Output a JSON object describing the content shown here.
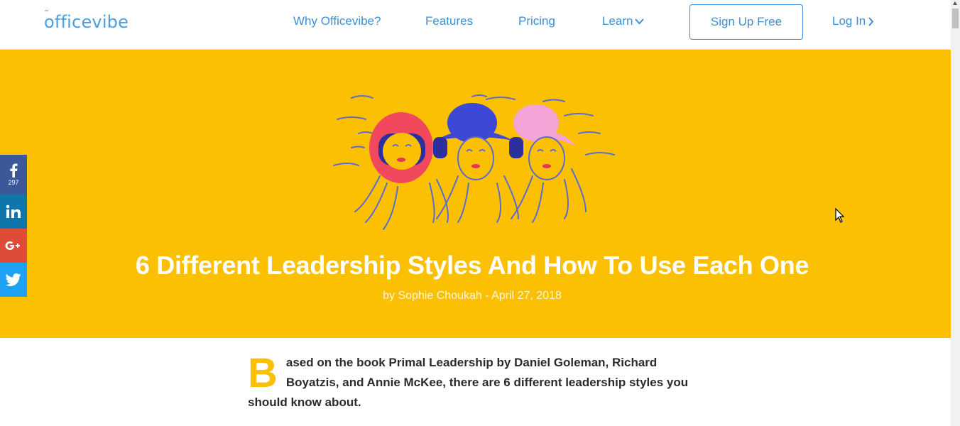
{
  "nav": {
    "logo": "officevibe",
    "links": [
      "Why Officevibe?",
      "Features",
      "Pricing",
      "Learn"
    ],
    "signup": "Sign Up Free",
    "login": "Log In"
  },
  "hero": {
    "title": "6 Different Leadership Styles And How To Use Each One",
    "meta": "by Sophie Choukah - April 27, 2018"
  },
  "share": {
    "facebook_count": "297"
  },
  "article": {
    "dropcap": "B",
    "intro": "ased on the book Primal Leadership by Daniel Goleman, Richard Boyatzis, and Annie McKee, there are 6 different leadership styles you should know about."
  },
  "colors": {
    "accent": "#fbc002",
    "link": "#3d8fd6",
    "facebook": "#3b5998",
    "linkedin": "#0e76a8",
    "google": "#dd4b39",
    "twitter": "#1da1f2"
  },
  "icons": [
    "officevibe-logo",
    "chevron-down-icon",
    "chevron-right-icon",
    "facebook-icon",
    "linkedin-icon",
    "google-plus-icon",
    "twitter-icon",
    "mouse-cursor-icon"
  ]
}
